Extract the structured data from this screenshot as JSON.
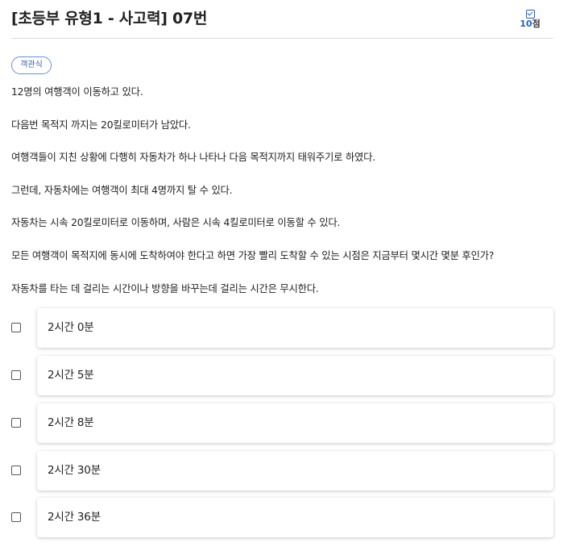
{
  "header": {
    "title": "[초등부 유형1 - 사고력] 07번",
    "points_value": "10",
    "points_unit": "점",
    "points_icon": "checkbox-icon"
  },
  "question": {
    "type_badge": "객관식",
    "lines": [
      "12명의 여행객이 이동하고 있다.",
      "다음번 목적지 까지는 20킬로미터가 남았다.",
      "여행객들이 지친 상황에 다행히 자동차가 하나 나타나 다음 목적지까지 태워주기로 하였다.",
      "그런데, 자동차에는 여행객이 최대 4명까지 탈 수 있다.",
      "자동차는 시속 20킬로미터로 이동하며, 사람은 시속 4킬로미터로 이동할 수 있다.",
      "모든 여행객이 목적지에 동시에 도착하여야 한다고 하면 가장 빨리 도착할 수 있는 시점은 지금부터 몇시간 몇분 후인가?",
      "자동차를 타는 데 걸리는 시간이나 방향을 바꾸는데 걸리는 시간은 무시한다."
    ]
  },
  "options": [
    {
      "label": "2시간 0분",
      "checked": false
    },
    {
      "label": "2시간 5분",
      "checked": false
    },
    {
      "label": "2시간 8분",
      "checked": false
    },
    {
      "label": "2시간 30분",
      "checked": false
    },
    {
      "label": "2시간 36분",
      "checked": false
    }
  ]
}
